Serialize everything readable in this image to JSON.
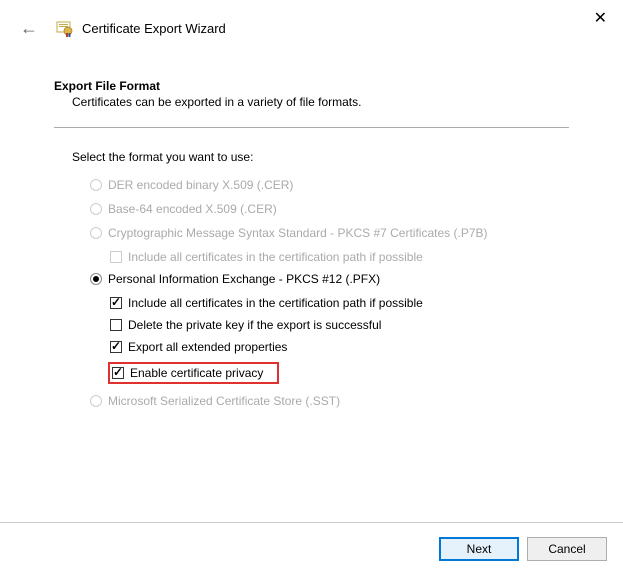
{
  "window": {
    "title": "Certificate Export Wizard"
  },
  "section": {
    "title": "Export File Format",
    "desc": "Certificates can be exported in a variety of file formats."
  },
  "prompt": "Select the format you want to use:",
  "options": {
    "der": "DER encoded binary X.509 (.CER)",
    "base64": "Base-64 encoded X.509 (.CER)",
    "pkcs7": "Cryptographic Message Syntax Standard - PKCS #7 Certificates (.P7B)",
    "pkcs7_include": "Include all certificates in the certification path if possible",
    "pfx": "Personal Information Exchange - PKCS #12 (.PFX)",
    "pfx_include": "Include all certificates in the certification path if possible",
    "pfx_delete": "Delete the private key if the export is successful",
    "pfx_export_ext": "Export all extended properties",
    "pfx_privacy": "Enable certificate privacy",
    "sst": "Microsoft Serialized Certificate Store (.SST)"
  },
  "buttons": {
    "next": "Next",
    "cancel": "Cancel"
  }
}
